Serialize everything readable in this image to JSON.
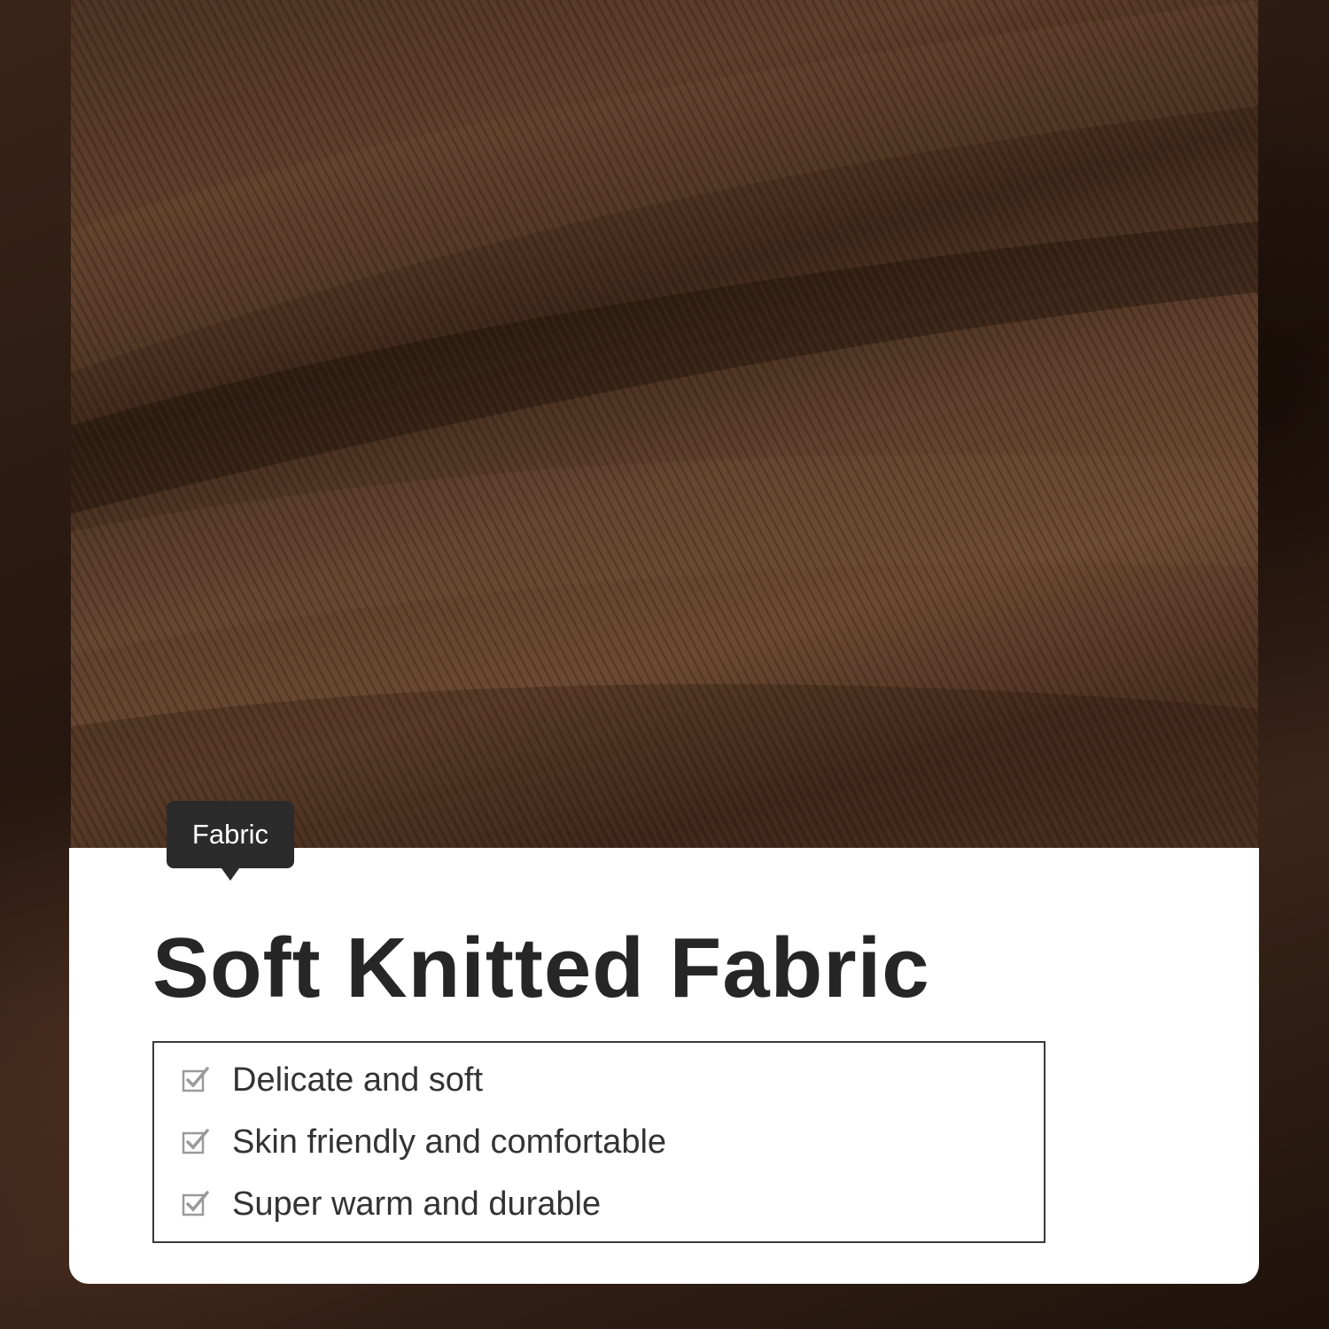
{
  "tag": {
    "label": "Fabric"
  },
  "headline": "Soft Knitted Fabric",
  "features": [
    {
      "label": "Delicate and soft",
      "icon": "checkbox-checked-icon"
    },
    {
      "label": "Skin friendly and comfortable",
      "icon": "checkbox-checked-icon"
    },
    {
      "label": "Super warm and durable",
      "icon": "checkbox-checked-icon"
    }
  ],
  "colors": {
    "fabric": "#5a3b28",
    "card": "#ffffff",
    "tag_bg": "#2b2b2b",
    "title": "#262626"
  }
}
